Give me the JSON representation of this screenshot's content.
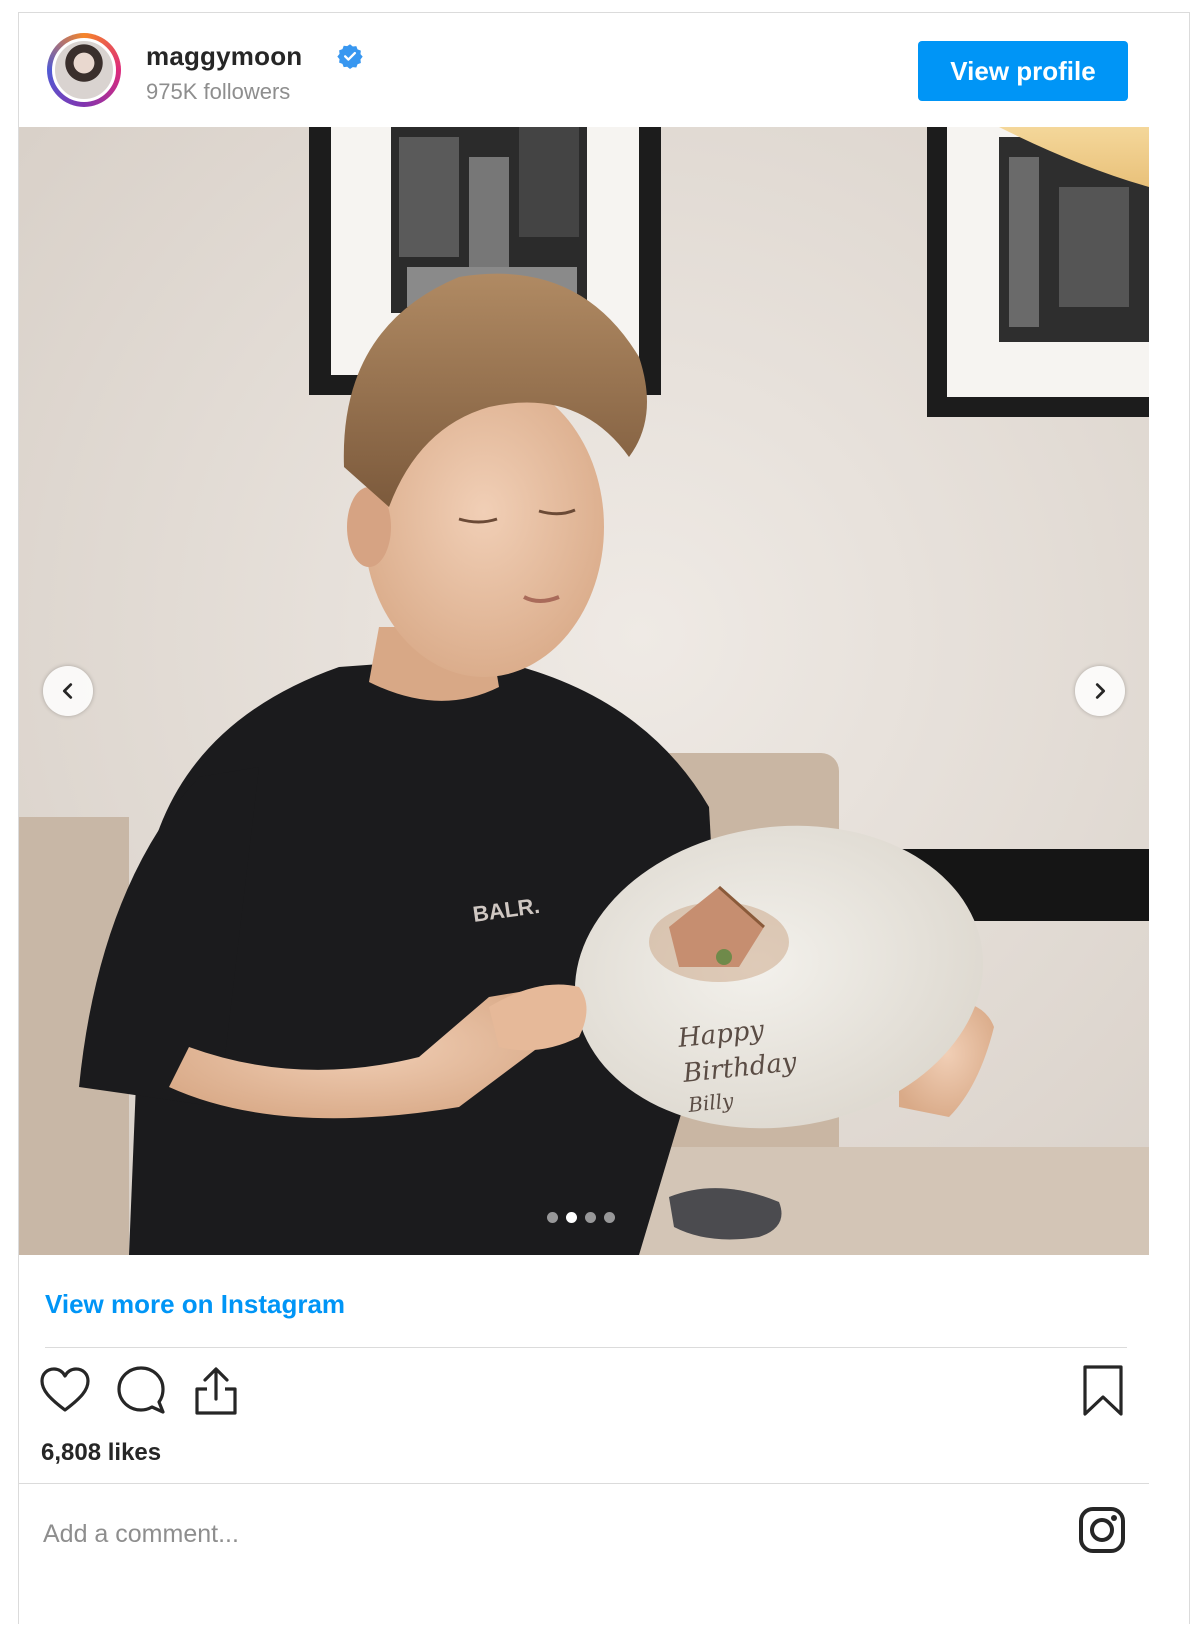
{
  "header": {
    "username": "maggymoon",
    "followers": "975K followers",
    "view_profile_label": "View profile"
  },
  "post": {
    "carousel_total": 4,
    "carousel_active_index": 2,
    "plate_text": [
      "Happy",
      "Birthday",
      "Billy"
    ],
    "shirt_text": "BALR."
  },
  "footer": {
    "view_more_label": "View more on Instagram",
    "likes": "6,808 likes",
    "comment_placeholder": "Add a comment..."
  },
  "colors": {
    "accent": "#0095f6",
    "text": "#262626",
    "muted": "#8e8e8e",
    "divider": "#dbdbdb"
  },
  "icons": [
    "verified-badge-icon",
    "chevron-left-icon",
    "chevron-right-icon",
    "heart-icon",
    "comment-icon",
    "share-icon",
    "bookmark-icon",
    "instagram-logo-icon"
  ]
}
